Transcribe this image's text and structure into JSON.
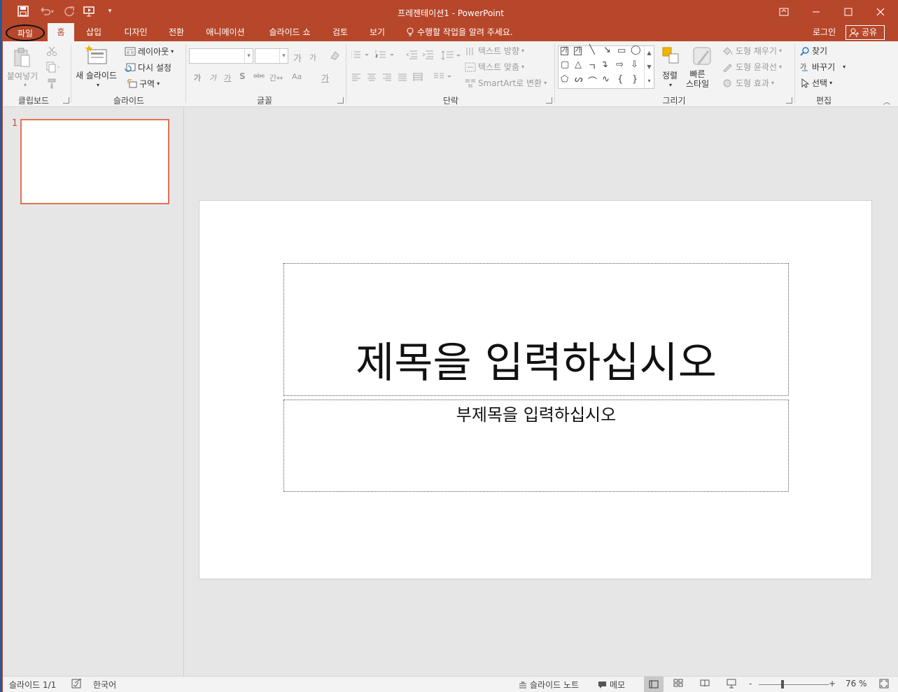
{
  "window": {
    "title": "프레젠테이션1 - PowerPoint"
  },
  "tabs": {
    "file": "파일",
    "items": [
      "홈",
      "삽입",
      "디자인",
      "전환",
      "애니메이션",
      "슬라이드 쇼",
      "검토",
      "보기"
    ],
    "active": "홈",
    "tell_me": "수행할 작업을 알려 주세요.",
    "login": "로그인",
    "share": "공유"
  },
  "ribbon": {
    "clipboard": {
      "label": "클립보드",
      "paste": "붙여넣기"
    },
    "slides": {
      "label": "슬라이드",
      "new_slide": "새 슬라이드",
      "layout": "레이아웃",
      "reset": "다시 설정",
      "section": "구역"
    },
    "font": {
      "label": "글꼴",
      "grow": "가",
      "shrink": "가",
      "bold": "가",
      "italic": "가",
      "underline": "가",
      "strike": "abc",
      "spacing": "간↔",
      "case": "Aa",
      "color": "가"
    },
    "paragraph": {
      "label": "단락",
      "text_direction": "텍스트 방향",
      "align_text": "텍스트 맞춤",
      "smartart": "SmartArt로 변환"
    },
    "drawing": {
      "label": "그리기",
      "arrange": "정렬",
      "quick_styles": "빠른\n스타일",
      "fill": "도형 채우기",
      "outline": "도형 윤곽선",
      "effects": "도형 효과"
    },
    "editing": {
      "label": "편집",
      "find": "찾기",
      "replace": "바꾸기",
      "select": "선택"
    }
  },
  "thumbnails": {
    "slide_number": "1"
  },
  "slide": {
    "title_placeholder": "제목을 입력하십시오",
    "subtitle_placeholder": "부제목을 입력하십시오"
  },
  "statusbar": {
    "slide_info": "슬라이드 1/1",
    "language": "한국어",
    "notes": "슬라이드 노트",
    "comments": "메모",
    "zoom": "76 %",
    "zoom_minus": "-",
    "zoom_plus": "+"
  },
  "colors": {
    "accent": "#b7472a",
    "thumb_border": "#e27157"
  }
}
